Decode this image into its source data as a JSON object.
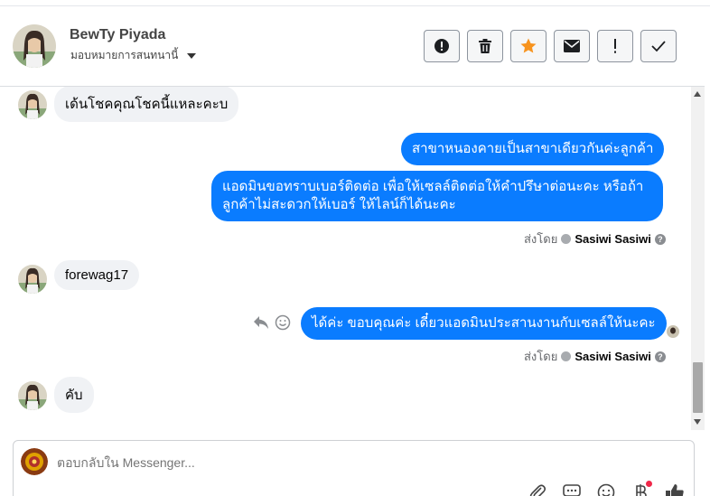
{
  "contact": {
    "name": "BewTy Piyada",
    "assign_label": "มอบหมายการสนทนานี้"
  },
  "toolbar": {
    "spam_icon": "alert-circle-icon",
    "delete_icon": "trash-icon",
    "star_icon": "star-icon",
    "mail_icon": "envelope-icon",
    "important_icon": "exclamation-icon",
    "done_icon": "check-icon",
    "star_color": "#f7931e"
  },
  "messages": {
    "m1": "เด้นโชคคุณโชคนี้แหละคะบ",
    "m2": "สาขาหนองคายเป็นสาขาเดียวกันค่ะลูกค้า",
    "m3_line1": "แอดมินขอทราบเบอร์ติดต่อ เพื่อให้เซลล์ติดต่อให้คำปรึษาต่อนะคะ หรือถ้า",
    "m3_line2": "ลูกค้าไม่สะดวกให้เบอร์ ให้ไลน์ก็ได้นะคะ",
    "m4": "forewag17",
    "m5": "ได้ค่ะ ขอบคุณค่ะ เดี๋ยวแอดมินประสานงานกับเซลล์ให้นะคะ",
    "m6": "คับ",
    "sent_by_label": "ส่งโดย",
    "sent_by_name": "Sasiwi Sasiwi",
    "help_glyph": "?"
  },
  "composer": {
    "placeholder": "ตอบกลับใน Messenger..."
  },
  "colors": {
    "outgoing": "#0a7cff",
    "incoming": "#f0f2f5"
  }
}
